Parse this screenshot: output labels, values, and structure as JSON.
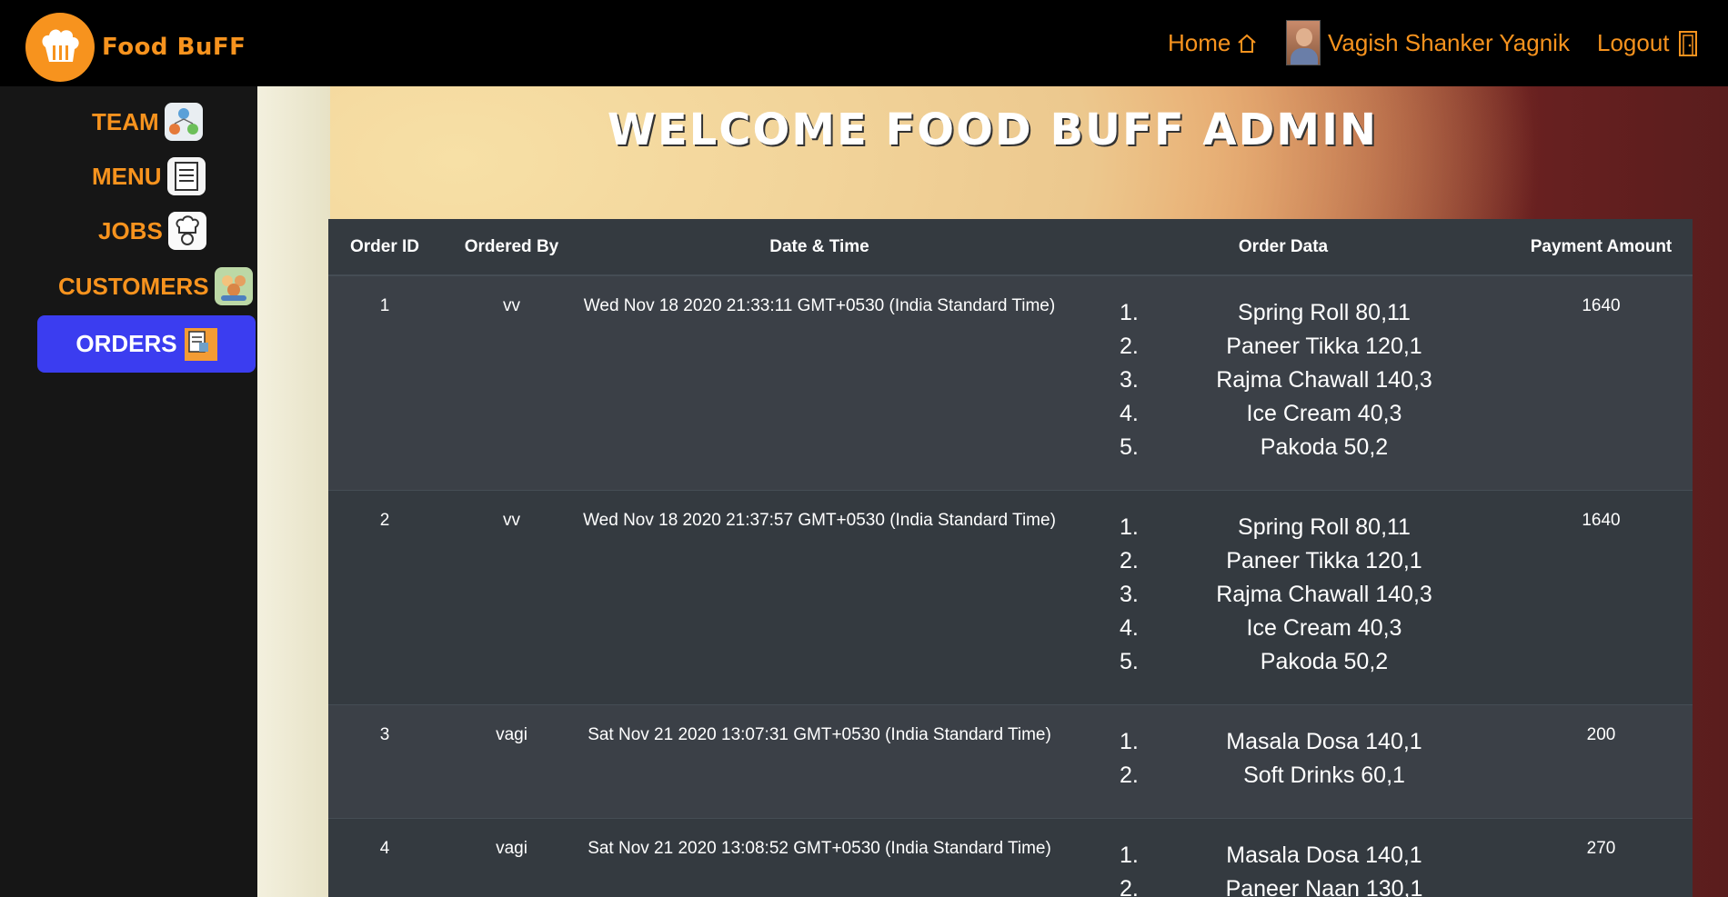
{
  "brand": {
    "name": "Food BuFF"
  },
  "nav": {
    "home_label": "Home",
    "user_name": "Vagish Shanker Yagnik",
    "logout_label": "Logout"
  },
  "sidebar": {
    "items": [
      {
        "label": "TEAM",
        "icon": "team-icon"
      },
      {
        "label": "MENU",
        "icon": "menu-card-icon"
      },
      {
        "label": "JOBS",
        "icon": "chef-icon"
      },
      {
        "label": "CUSTOMERS",
        "icon": "customers-icon"
      },
      {
        "label": "ORDERS",
        "icon": "orders-icon",
        "active": true
      }
    ]
  },
  "main": {
    "welcome": "WELCOME FOOD BUFF ADMIN"
  },
  "table": {
    "headers": [
      "Order ID",
      "Ordered By",
      "Date & Time",
      "Order Data",
      "Payment Amount"
    ],
    "rows": [
      {
        "id": "1",
        "by": "vv",
        "datetime": "Wed Nov 18 2020 21:33:11 GMT+0530 (India Standard Time)",
        "items": [
          "Spring Roll 80,11",
          "Paneer Tikka 120,1",
          "Rajma Chawall 140,3",
          "Ice Cream 40,3",
          "Pakoda 50,2"
        ],
        "amount": "1640"
      },
      {
        "id": "2",
        "by": "vv",
        "datetime": "Wed Nov 18 2020 21:37:57 GMT+0530 (India Standard Time)",
        "items": [
          "Spring Roll 80,11",
          "Paneer Tikka 120,1",
          "Rajma Chawall 140,3",
          "Ice Cream 40,3",
          "Pakoda 50,2"
        ],
        "amount": "1640"
      },
      {
        "id": "3",
        "by": "vagi",
        "datetime": "Sat Nov 21 2020 13:07:31 GMT+0530 (India Standard Time)",
        "items": [
          "Masala Dosa 140,1",
          "Soft Drinks 60,1"
        ],
        "amount": "200"
      },
      {
        "id": "4",
        "by": "vagi",
        "datetime": "Sat Nov 21 2020 13:08:52 GMT+0530 (India Standard Time)",
        "items": [
          "Masala Dosa 140,1",
          "Paneer Naan 130,1"
        ],
        "amount": "270"
      }
    ]
  },
  "colors": {
    "accent": "#f7931e",
    "active": "#3b3df0",
    "table_bg": "#343a40"
  }
}
